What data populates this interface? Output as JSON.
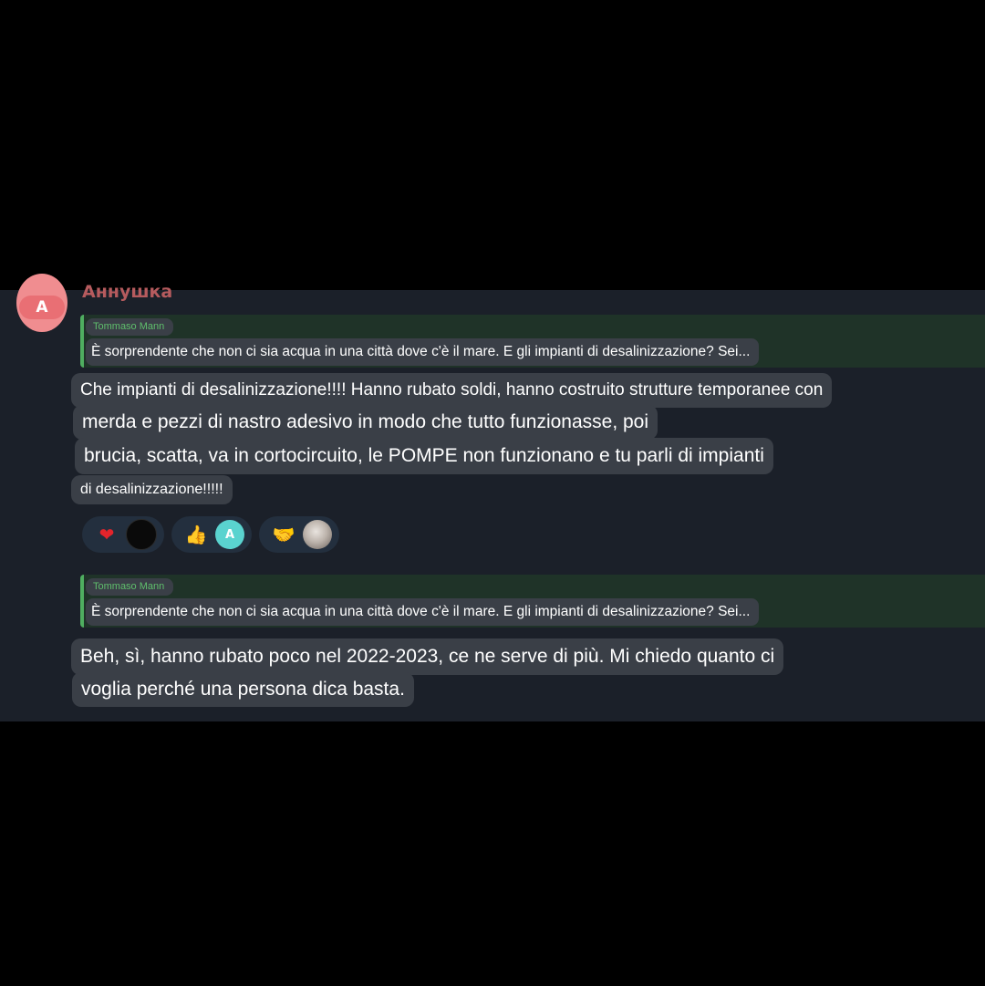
{
  "sender": {
    "initial": "A",
    "name": "Аннушка",
    "name_color": "#b65b5e",
    "avatar_color": "#f08d90"
  },
  "messages": [
    {
      "reply": {
        "author": "Tommaso Mann",
        "text": "È sorprendente che non ci sia acqua in una città dove c'è il mare. E gli impianti di desalinizzazione? Sei..."
      },
      "lines": [
        "Che impianti di desalinizzazione!!!! Hanno rubato soldi, hanno costruito strutture temporanee con",
        "merda e pezzi di nastro adesivo in modo che tutto funzionasse, poi",
        "brucia, scatta, va in cortocircuito, le POMPE non funzionano e tu parli di impianti",
        "di desalinizzazione!!!!!"
      ],
      "reactions": [
        {
          "emoji": "heart-emoji",
          "glyph": "❤",
          "reactor": "dark-avatar"
        },
        {
          "emoji": "thumbs-up-emoji",
          "glyph": "👍",
          "reactor_initial": "A"
        },
        {
          "emoji": "handshake-emoji",
          "glyph": "🤝",
          "reactor": "photo-avatar"
        }
      ]
    },
    {
      "reply": {
        "author": "Tommaso Mann",
        "text": "È sorprendente che non ci sia acqua in una città dove c'è il mare. E gli impianti di desalinizzazione? Sei..."
      },
      "lines": [
        "Beh, sì, hanno rubato poco nel 2022-2023, ce ne serve di più. Mi chiedo quanto ci",
        "voglia perché una persona dica basta."
      ]
    }
  ],
  "colors": {
    "page_background": "#000000",
    "chat_background": "#1b2029",
    "bubble": "#3a3f47",
    "reply_accent": "#4fae60",
    "reply_author": "#5fbf6c",
    "reaction_pill": "#232f3e",
    "heart": "#e3242b",
    "teal_avatar": "#5ad3cf"
  }
}
